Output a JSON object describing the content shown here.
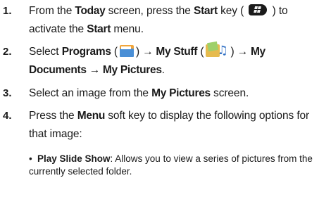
{
  "steps": [
    {
      "num": "1.",
      "line1": {
        "t1": "From the ",
        "b1": "Today",
        "t2": " screen, press the ",
        "b2": "Start",
        "t3": " key ( ",
        "t4": " ) to"
      },
      "line2": {
        "t1": "activate the ",
        "b1": "Start",
        "t2": " menu."
      }
    },
    {
      "num": "2.",
      "line1": {
        "t1": "Select ",
        "b1": "Programs",
        "t2": " (",
        "t3": ") ",
        "arrow1": "→",
        "b2": " My Stuff",
        "t4": " (",
        "t5": ") ",
        "arrow2": "→",
        "b3": " My"
      },
      "line2": {
        "b1": "Documents ",
        "arrow": "→",
        "b2": " My Pictures",
        "t1": "."
      }
    },
    {
      "num": "3.",
      "line1": {
        "t1": "Select an image from the ",
        "b1": "My Pictures",
        "t2": " screen."
      }
    },
    {
      "num": "4.",
      "line1": {
        "t1": "Press the ",
        "b1": "Menu",
        "t2": " soft key to display the following options for"
      },
      "line2": {
        "t1": "that image:"
      }
    }
  ],
  "bullets": [
    {
      "dot": "•",
      "label": "Play Slide Show",
      "text": ": Allows you to view a series of pictures from the",
      "cont": "currently selected folder."
    }
  ],
  "icons": {
    "start_key": "windows-start-key-icon",
    "programs": "programs-folder-icon",
    "my_stuff": "my-stuff-folder-icon"
  }
}
